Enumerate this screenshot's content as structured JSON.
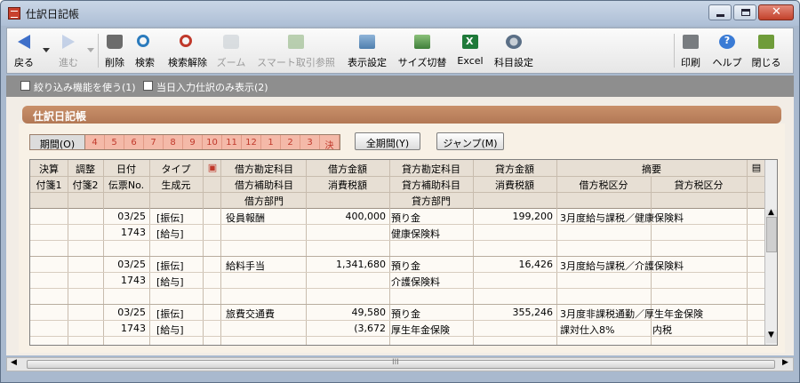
{
  "window": {
    "title": "仕訳日記帳"
  },
  "toolbar": {
    "back": "戻る",
    "forward": "進む",
    "delete": "削除",
    "search": "検索",
    "search_clear": "検索解除",
    "zoom": "ズーム",
    "smart": "スマート取引参照",
    "display": "表示設定",
    "size": "サイズ切替",
    "excel": "Excel",
    "account": "科目設定",
    "print": "印刷",
    "help": "ヘルプ",
    "close": "閉じる"
  },
  "options": {
    "filter": "絞り込み機能を使う(1)",
    "today_only": "当日入力仕訳のみ表示(2)"
  },
  "panel": {
    "title": "仕訳日記帳"
  },
  "period": {
    "label": "期間(O)",
    "months": [
      "4",
      "5",
      "6",
      "7",
      "8",
      "9",
      "10",
      "11",
      "12",
      "1",
      "2",
      "3",
      "決"
    ],
    "all_button": "全期間(Y)",
    "jump_button": "ジャンプ(M)"
  },
  "columns": {
    "kessan": "決算",
    "chosei": "調整",
    "date": "日付",
    "type": "タイプ",
    "debit_account": "借方勘定科目",
    "debit_amount": "借方金額",
    "credit_account": "貸方勘定科目",
    "credit_amount": "貸方金額",
    "summary": "摘要",
    "fusen1": "付箋1",
    "fusen2": "付箋2",
    "voucher": "伝票No.",
    "origin": "生成元",
    "debit_sub": "借方補助科目",
    "consumption_tax": "消費税額",
    "credit_sub": "貸方補助科目",
    "consumption_tax2": "消費税額",
    "debit_tax": "借方税区分",
    "credit_tax": "貸方税区分",
    "debit_dept": "借方部門",
    "credit_dept": "貸方部門"
  },
  "rows": [
    {
      "date": "03/25",
      "voucher": "1743",
      "type": "[振伝]",
      "origin": "[給与]",
      "debit_account": "役員報酬",
      "debit_amount": "400,000",
      "debit_tax": "",
      "credit_account": "預り金",
      "credit_sub": "健康保険料",
      "credit_amount": "199,200",
      "summary": "3月度給与課税／健康保険料",
      "tax1": "",
      "tax2": ""
    },
    {
      "date": "03/25",
      "voucher": "1743",
      "type": "[振伝]",
      "origin": "[給与]",
      "debit_account": "給料手当",
      "debit_amount": "1,341,680",
      "debit_tax": "",
      "credit_account": "預り金",
      "credit_sub": "介護保険料",
      "credit_amount": "16,426",
      "summary": "3月度給与課税／介護保険料",
      "tax1": "",
      "tax2": ""
    },
    {
      "date": "03/25",
      "voucher": "1743",
      "type": "[振伝]",
      "origin": "[給与]",
      "debit_account": "旅費交通費",
      "debit_amount": "49,580",
      "debit_tax": "(3,672",
      "credit_account": "預り金",
      "credit_sub": "厚生年金保険",
      "credit_amount": "355,246",
      "summary": "3月度非課税通勤／厚生年金保険",
      "tax1": "課対仕入8%",
      "tax2": "内税"
    }
  ],
  "scroll": {
    "hthumb_label": "III"
  }
}
